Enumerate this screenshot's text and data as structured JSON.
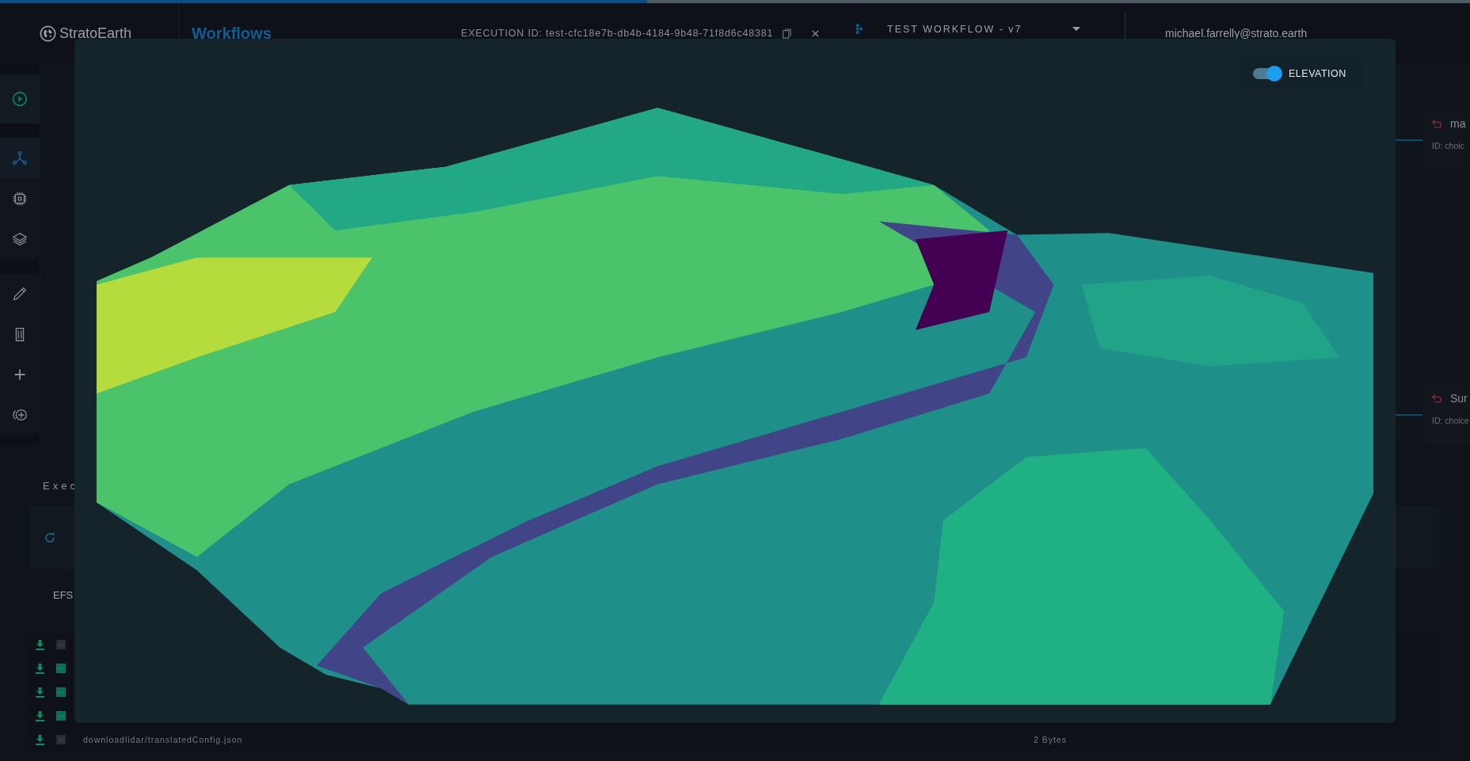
{
  "progress": {
    "level": 0.44
  },
  "header": {
    "logo": "StratoEarth",
    "page_title": "Workflows",
    "execution_id": "EXECUTION ID: test-cfc18e7b-db4b-4184-9b48-71f8d6c48381",
    "workflow_select": "TEST WORKFLOW - v7",
    "user": "michael.farrelly@strato.earth"
  },
  "sidebar": {
    "groups": [
      [
        {
          "kind": "play",
          "selected": false
        }
      ],
      [
        {
          "kind": "graph",
          "selected": true
        },
        {
          "kind": "chip",
          "selected": false
        },
        {
          "kind": "layers",
          "selected": false
        }
      ],
      [
        {
          "kind": "pencil",
          "selected": false
        },
        {
          "kind": "trash",
          "selected": false
        },
        {
          "kind": "plus",
          "selected": false
        },
        {
          "kind": "add-circle",
          "selected": false
        }
      ]
    ]
  },
  "cards": [
    {
      "title": "ma",
      "id": "ID: choic"
    },
    {
      "title": "Sur",
      "id": "ID: choice"
    }
  ],
  "executions_panel": {
    "title": "Exec",
    "storage_label": "EFS",
    "files": [
      {
        "previewable": false
      },
      {
        "previewable": true
      },
      {
        "previewable": true
      },
      {
        "previewable": true
      },
      {
        "previewable": false,
        "name": "downloadlidar/translatedConfig.json",
        "size": "2 Bytes"
      }
    ]
  },
  "modal": {
    "toggle": {
      "label": "ELEVATION",
      "on": true
    }
  }
}
